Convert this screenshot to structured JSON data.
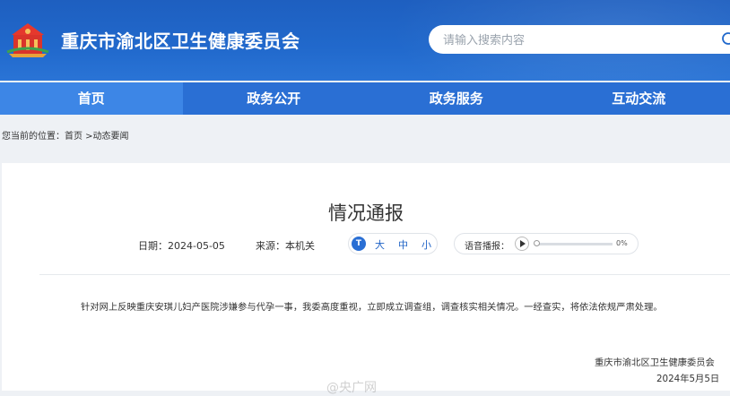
{
  "header": {
    "site_title": "重庆市渝北区卫生健康委员会",
    "logo_icon": "government-emblem-icon",
    "search_placeholder": "请输入搜索内容",
    "search_icon": "search-icon"
  },
  "nav": {
    "items": [
      {
        "label": "首页",
        "active": true
      },
      {
        "label": "政务公开",
        "active": false
      },
      {
        "label": "政务服务",
        "active": false
      },
      {
        "label": "互动交流",
        "active": false
      }
    ]
  },
  "breadcrumb": "您当前的位置：首页 >动态要闻",
  "article": {
    "title": "情况通报",
    "date": "日期：2024-05-05",
    "source": "来源：本机关",
    "font_size": {
      "icon": "font-size-icon",
      "icon_text": "T",
      "large": "大",
      "medium": "中",
      "small": "小"
    },
    "audio": {
      "label": "语音播报：",
      "progress": "0%"
    },
    "body": "针对网上反映重庆安琪儿妇产医院涉嫌参与代孕一事，我委高度重视，立即成立调查组，调查核实相关情况。一经查实，将依法依规严肃处理。",
    "signature_org": "重庆市渝北区卫生健康委员会",
    "signature_date": "2024年5月5日"
  },
  "watermark": "@央广网",
  "colors": {
    "primary": "#2169cc",
    "nav_active": "#3d86e6",
    "accent_text": "#1f63c6"
  }
}
